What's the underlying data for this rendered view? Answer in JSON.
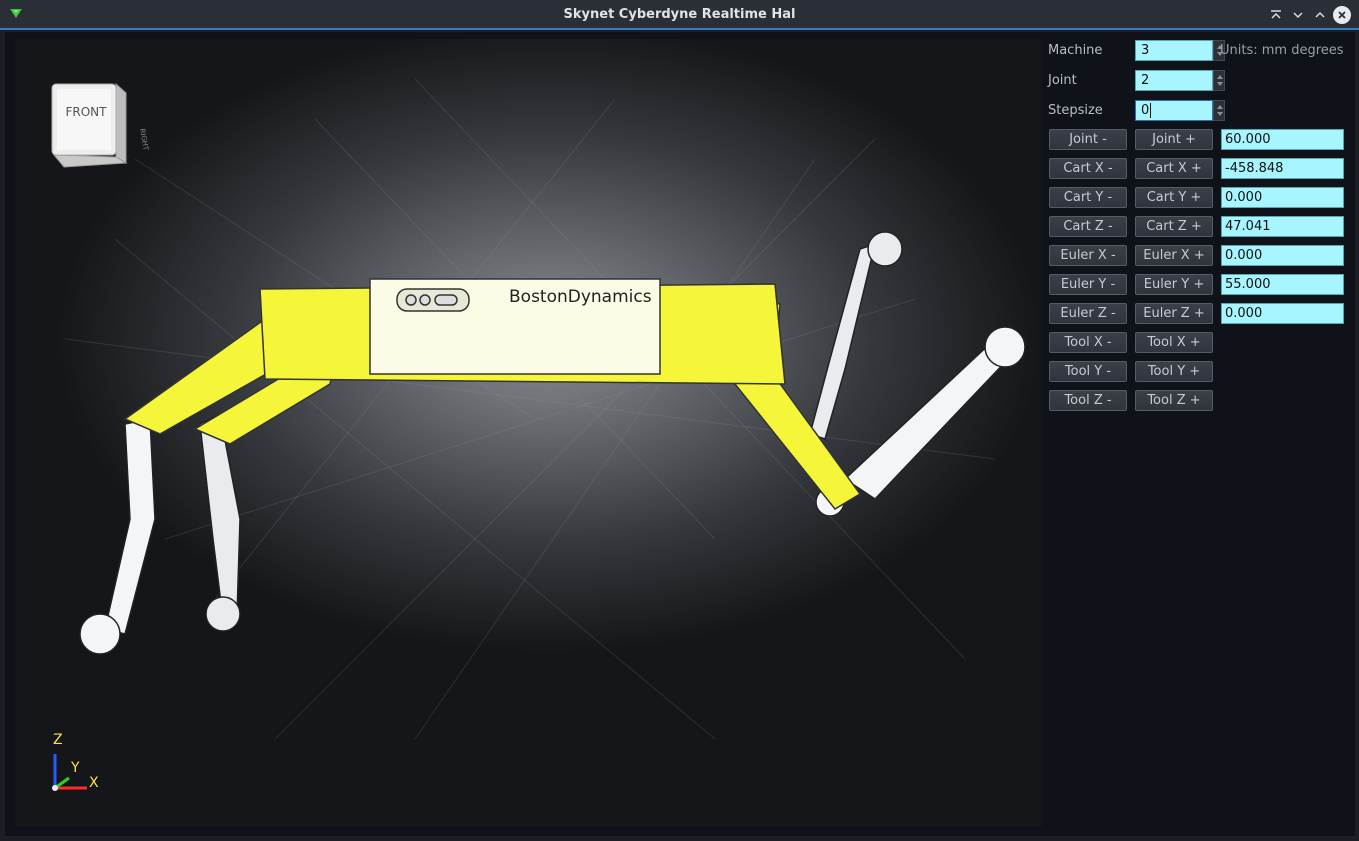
{
  "window": {
    "title": "Skynet Cyberdyne Realtime Hal"
  },
  "viewport": {
    "navcube_face": "FRONT",
    "navcube_side": "RIGHT",
    "robot_logo": "BostonDynamics",
    "axes": {
      "z": "Z",
      "y": "Y",
      "x": "X"
    }
  },
  "panel": {
    "machine_label": "Machine",
    "machine_value": "3",
    "joint_label": "Joint",
    "joint_value": "2",
    "stepsize_label": "Stepsize",
    "stepsize_value": "0",
    "units_text": "Units: mm degrees",
    "rows": [
      {
        "minus": "Joint -",
        "plus": "Joint +",
        "value": "60.000"
      },
      {
        "minus": "Cart X -",
        "plus": "Cart X +",
        "value": "-458.848"
      },
      {
        "minus": "Cart Y -",
        "plus": "Cart Y +",
        "value": "0.000"
      },
      {
        "minus": "Cart Z -",
        "plus": "Cart Z +",
        "value": "47.041"
      },
      {
        "minus": "Euler X -",
        "plus": "Euler X +",
        "value": "0.000"
      },
      {
        "minus": "Euler Y -",
        "plus": "Euler Y +",
        "value": "55.000"
      },
      {
        "minus": "Euler Z -",
        "plus": "Euler Z +",
        "value": "0.000"
      },
      {
        "minus": "Tool X -",
        "plus": "Tool X +"
      },
      {
        "minus": "Tool Y -",
        "plus": "Tool Y +"
      },
      {
        "minus": "Tool Z -",
        "plus": "Tool Z +"
      }
    ]
  },
  "colors": {
    "field_bg": "#a6f5ff",
    "robot_yellow": "#f5f53a",
    "title_accent": "#3d7ab8"
  }
}
